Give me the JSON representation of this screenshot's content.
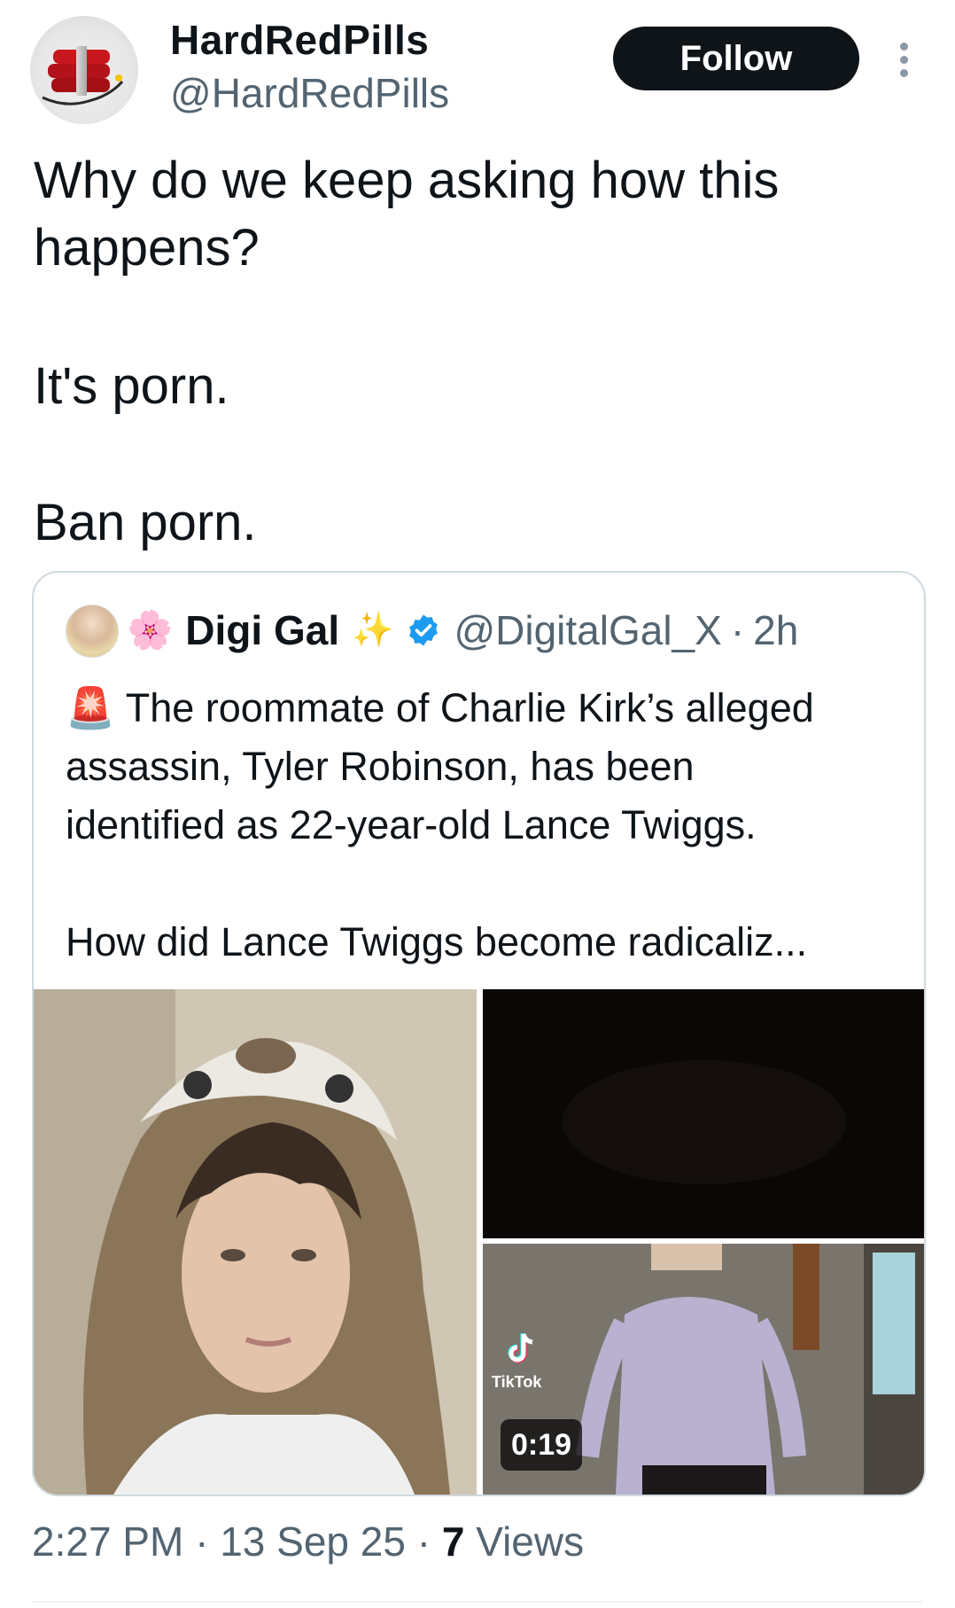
{
  "author": {
    "name": "HardRedPills",
    "handle": "@HardRedPills",
    "avatar_icon": "dynamite-bundle-icon"
  },
  "follow_label": "Follow",
  "tweet": {
    "line1": "Why do we keep asking how this",
    "line2": "happens?",
    "line3": "It's porn.",
    "line4": "Ban porn."
  },
  "quote": {
    "flower_emoji": "🌸",
    "name": "Digi Gal",
    "sparkle_emoji": "✨",
    "handle": "@DigitalGal_X",
    "separator": "·",
    "time": "2h",
    "siren_emoji": "🚨",
    "text_line1": "The roommate of Charlie Kirk’s alleged",
    "text_line2": "assassin, Tyler Robinson, has been",
    "text_line3": "identified as 22-year-old Lance Twiggs.",
    "text_line4": "How did Lance Twiggs become radicaliz...",
    "media": {
      "tiktok_label": "TikTok",
      "duration": "0:19"
    }
  },
  "meta": {
    "time": "2:27 PM",
    "sep1": "·",
    "date": "13 Sep 25",
    "sep2": "·",
    "views_count": "7",
    "views_label": "Views"
  },
  "colors": {
    "text_primary": "#0f1419",
    "text_secondary": "#536471",
    "follow_bg": "#0f1419",
    "verified_blue": "#1d9bf0",
    "border": "#cfd9de"
  }
}
